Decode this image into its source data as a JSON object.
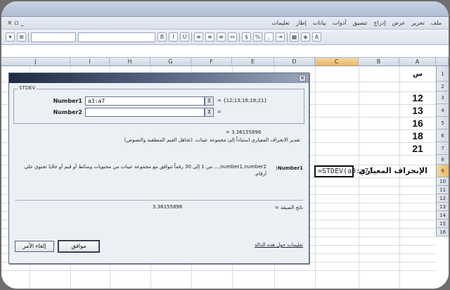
{
  "menu": {
    "items": [
      "ملف",
      "تحرير",
      "عرض",
      "إدراج",
      "تنسيق",
      "أدوات",
      "بيانات",
      "إطار",
      "تعليمات"
    ]
  },
  "columns": [
    "A",
    "B",
    "C",
    "D",
    "E",
    "F",
    "G",
    "H",
    "I",
    "J"
  ],
  "rows": [
    "1",
    "2",
    "3",
    "4",
    "5",
    "6",
    "7",
    "8",
    "9",
    "10",
    "11",
    "12",
    "13",
    "14",
    "15",
    "16"
  ],
  "cells": {
    "a1": "س",
    "a3": "12",
    "a4": "13",
    "a5": "16",
    "a6": "18",
    "a7": "21",
    "label_b9": "الإنحراف المعياري",
    "active_c9": "=STDEV(a3:a7)"
  },
  "dialog": {
    "function_name": "STDEV",
    "number1_label": "Number1",
    "number1_value": "a3:a7",
    "number1_result": "= {12;13;16;18;21}",
    "number2_label": "Number2",
    "number2_result": "=",
    "formula_result_value": "= 3.36155896",
    "description": "تقدير الانحراف المعياري استناداً إلى مجموعة عينات. (تجاهل القيم المنطقية والنصوص)",
    "arg_label": "Number1:",
    "arg_help": "number1,number2,... من 1 إلى 30 رقماً تتوافق مع مجموعة عينات من محتويات وسائط أو قيم أو خلايا تحتوي على أرقام.",
    "result_label": "ناتج الصيغة =",
    "result_value": "3.36155896",
    "help_link": "تعليمات حول هذه الدالة",
    "ok_label": "موافق",
    "cancel_label": "إلغاء الأمر"
  }
}
